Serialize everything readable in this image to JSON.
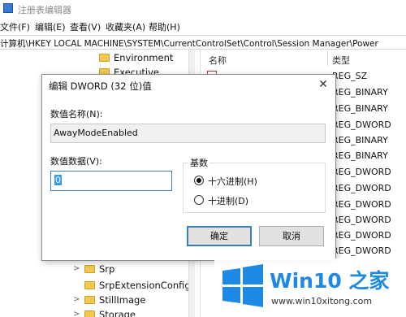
{
  "window": {
    "title": "注册表编辑器"
  },
  "menu": [
    "文件(F)",
    "编辑(E)",
    "查看(V)",
    "收藏夹(A)",
    "帮助(H)"
  ],
  "address": {
    "path": "计算机\\HKEY LOCAL MACHINE\\SYSTEM\\CurrentControlSet\\Control\\Session Manager\\Power"
  },
  "tree": {
    "nodes": [
      {
        "label": "Environment",
        "chevron": ""
      },
      {
        "label": "Executive",
        "chevron": ""
      },
      {
        "label": "Srp",
        "chevron": ">"
      },
      {
        "label": "SrpExtensionConfig",
        "chevron": ""
      },
      {
        "label": "StillImage",
        "chevron": ">"
      },
      {
        "label": "Storage",
        "chevron": ">"
      }
    ]
  },
  "values_pane": {
    "headers": {
      "name": "名称",
      "type": "类型"
    },
    "types": [
      "REG_SZ",
      "REG_BINARY",
      "REG_BINARY",
      "REG_DWORD",
      "REG_BINARY",
      "REG_BINARY",
      "REG_DWORD",
      "REG_DWORD",
      "REG_DWORD",
      "REG_DWORD",
      "REG_DWORD",
      "REG_DWORD"
    ]
  },
  "dialog": {
    "title": "编辑 DWORD (32 位)值",
    "close_glyph": "✕",
    "name_label": "数值名称(N):",
    "name_value": "AwayModeEnabled",
    "data_label": "数值数据(V):",
    "data_value": "0",
    "base_label": "基数",
    "radios": [
      {
        "label": "十六进制(H)",
        "checked": true
      },
      {
        "label": "十进制(D)",
        "checked": false
      }
    ],
    "ok_label": "确定",
    "cancel_label": "取消"
  },
  "watermark": {
    "brand": "Win10 之家",
    "url": "www.win10xitong.com"
  },
  "colors": {
    "accent": "#3c7fb1",
    "selection": "#3399ff",
    "brand_blue": "#1e88e5"
  }
}
